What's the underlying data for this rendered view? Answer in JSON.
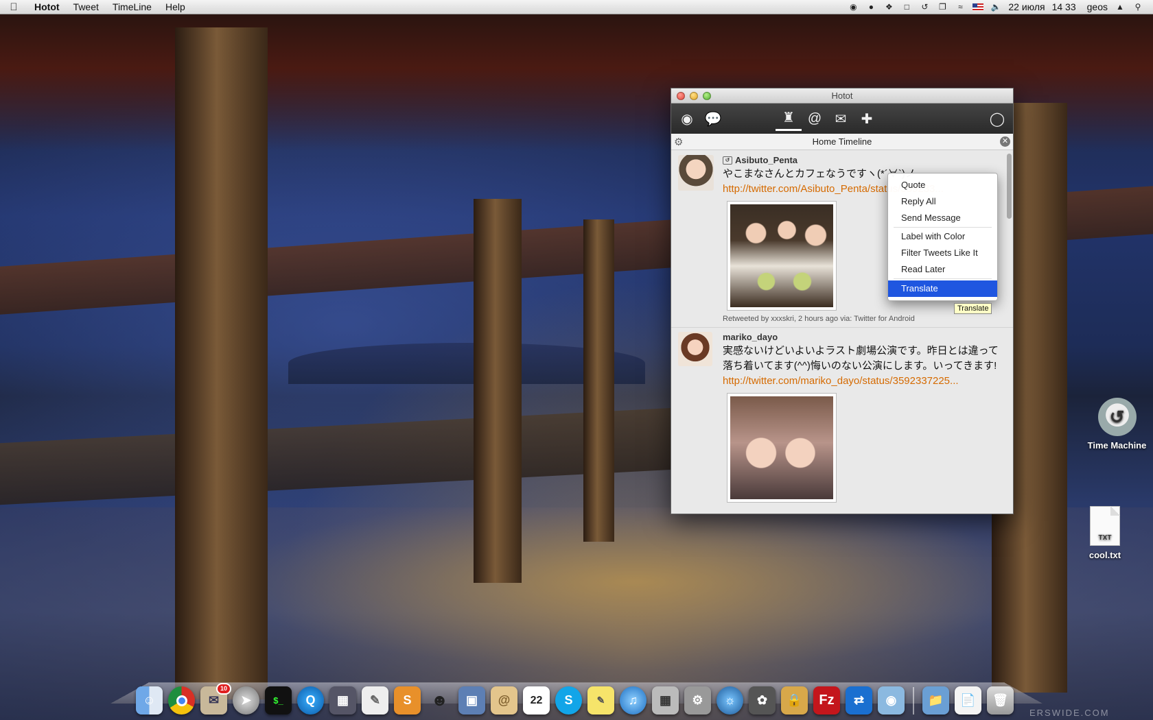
{
  "menubar": {
    "app": "Hotot",
    "items": [
      "Tweet",
      "TimeLine",
      "Help"
    ],
    "date": "22 июля",
    "time": "14 33",
    "user": "geos"
  },
  "window": {
    "title": "Hotot",
    "column_title": "Home Timeline"
  },
  "tweets": [
    {
      "user": "Asibuto_Penta",
      "text": "やこまなさんとカフェなうですヽ(*´∀`)ノ",
      "link": "http://twitter.com/Asibuto_Penta/status/359233...",
      "meta_prefix": "Retweeted by",
      "meta_who": "xxxskri",
      "meta_suffix": ", 2 hours ago via: Twitter for Android"
    },
    {
      "user": "mariko_dayo",
      "text": "実感ないけどいよいよラスト劇場公演です。昨日とは違って落ち着いてます(^^)悔いのない公演にします。いってきます!",
      "link": "http://twitter.com/mariko_dayo/status/3592337225..."
    }
  ],
  "context_menu": {
    "items": [
      "Quote",
      "Reply All",
      "Send Message",
      "Label with Color",
      "Filter Tweets Like It",
      "Read Later",
      "Translate"
    ],
    "highlighted": "Translate"
  },
  "tooltip": "Translate",
  "desktop": {
    "time_machine": "Time Machine",
    "txt_file": "cool.txt",
    "txt_badge": "TXT"
  },
  "dock": {
    "calendar_day": "22",
    "mail_badge": "10"
  },
  "watermark": "ERSWIDE.COM",
  "colors": {
    "link": "#d56a00",
    "menu_highlight": "#1f56e0"
  }
}
